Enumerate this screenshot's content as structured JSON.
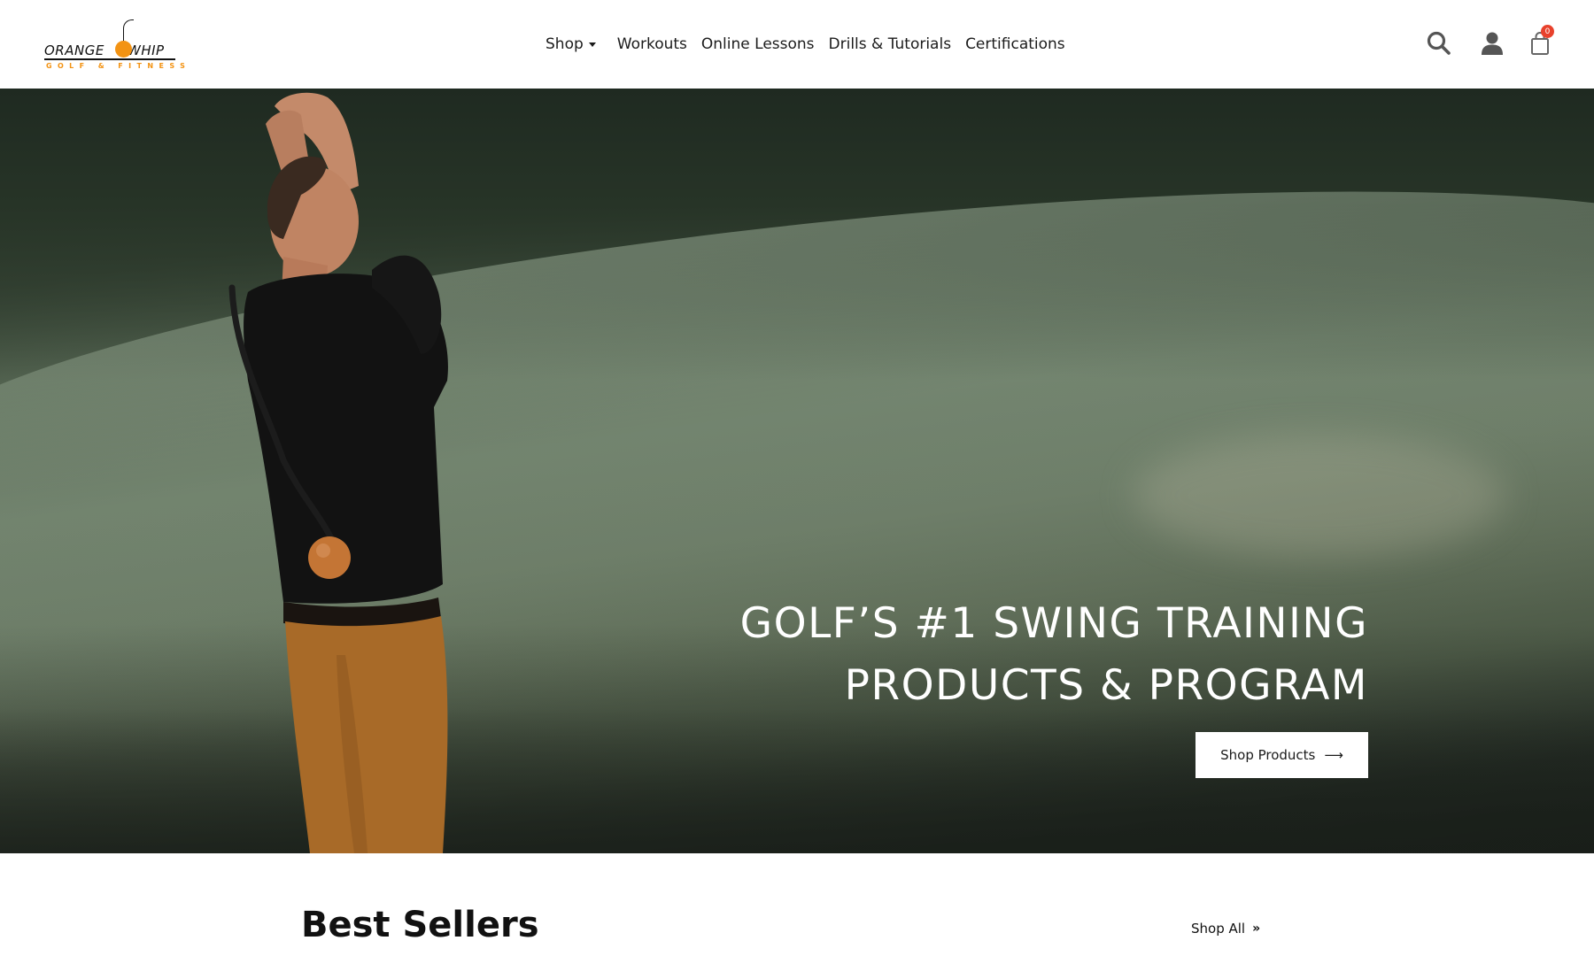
{
  "header": {
    "logo": {
      "word_left": "ORANGE",
      "word_right": "WHIP",
      "tagline": "GOLF & FITNESS"
    },
    "nav": [
      {
        "label": "Shop",
        "has_dropdown": true
      },
      {
        "label": "Workouts"
      },
      {
        "label": "Online Lessons"
      },
      {
        "label": "Drills & Tutorials"
      },
      {
        "label": "Certifications"
      }
    ],
    "icons": [
      "search-icon",
      "user-icon",
      "cart-icon"
    ],
    "cart_count": "0"
  },
  "hero": {
    "headline_line1": "GOLF’S #1 SWING TRAINING",
    "headline_line2": "PRODUCTS & PROGRAM",
    "cta_label": "Shop Products",
    "cta_icon": "arrow-right-icon"
  },
  "best_sellers": {
    "title": "Best Sellers",
    "link_label": "Shop All",
    "link_icon": "double-chevron-right-icon"
  },
  "colors": {
    "brand_orange": "#f39313",
    "cart_badge": "#e8412c",
    "text_dark": "#1b1b1b"
  }
}
